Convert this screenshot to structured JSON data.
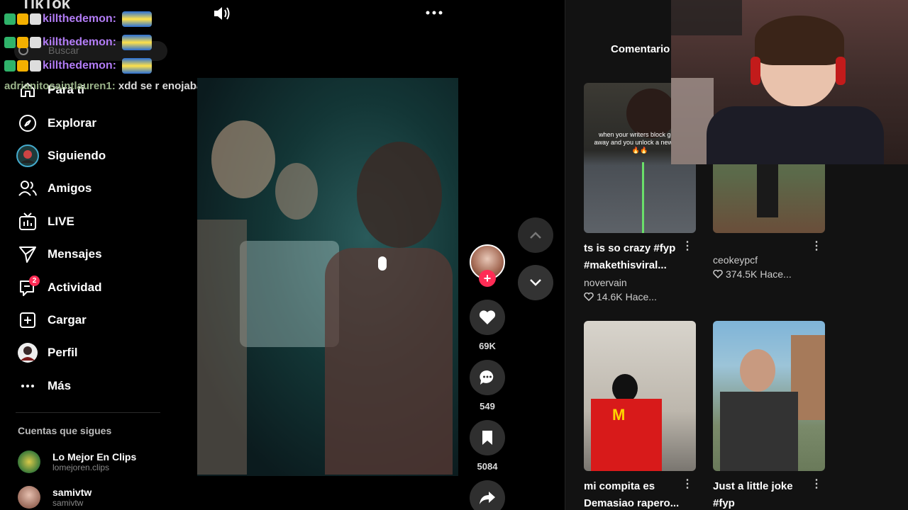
{
  "app": {
    "logo": "TikTok"
  },
  "search": {
    "placeholder": "Buscar"
  },
  "sidebar": {
    "items": [
      {
        "label": "Para ti",
        "icon": "home-icon"
      },
      {
        "label": "Explorar",
        "icon": "compass-icon"
      },
      {
        "label": "Siguiendo",
        "icon": "following-avatar-icon"
      },
      {
        "label": "Amigos",
        "icon": "friends-icon"
      },
      {
        "label": "LIVE",
        "icon": "live-tv-icon"
      },
      {
        "label": "Mensajes",
        "icon": "send-icon"
      },
      {
        "label": "Actividad",
        "icon": "activity-icon",
        "badge": "2"
      },
      {
        "label": "Cargar",
        "icon": "upload-icon"
      },
      {
        "label": "Perfil",
        "icon": "profile-avatar-icon"
      },
      {
        "label": "Más",
        "icon": "more-dots-icon"
      }
    ],
    "following_title": "Cuentas que sigues",
    "accounts": [
      {
        "name": "Lo Mejor En Clips",
        "handle": "lomejoren.clips"
      },
      {
        "name": "samivtw",
        "handle": "samivtw"
      }
    ]
  },
  "chat": {
    "lines": [
      {
        "user": "killthedemon:"
      },
      {
        "user": "killthedemon:"
      },
      {
        "user": "killthedemon:"
      }
    ],
    "line4": {
      "user": "adrianitosaintlauren1:",
      "message": " xdd se r enojaba"
    }
  },
  "video": {
    "likes": "69K",
    "comments": "549",
    "saves": "5084"
  },
  "right_panel": {
    "tab": "Comentario",
    "videos": [
      {
        "overlay_text": "when your writers block goes away and you unlock a new flow 🔥🔥",
        "title": "ts is so crazy #fyp #makethisviral...",
        "author": "novervain",
        "likes": "14.6K",
        "time": "Hace..."
      },
      {
        "overlay_text": "",
        "title": "",
        "author": "ceokeypcf",
        "likes": "374.5K",
        "time": "Hace..."
      },
      {
        "overlay_text": "",
        "title": "mi compita es Demasiao rapero...",
        "author": "",
        "likes": "",
        "time": ""
      },
      {
        "overlay_text": "",
        "title": "Just a little joke #fyp",
        "author": "",
        "likes": "",
        "time": ""
      }
    ]
  },
  "colors": {
    "accent": "#fe2c55",
    "chat_user": "#b27cf5"
  }
}
